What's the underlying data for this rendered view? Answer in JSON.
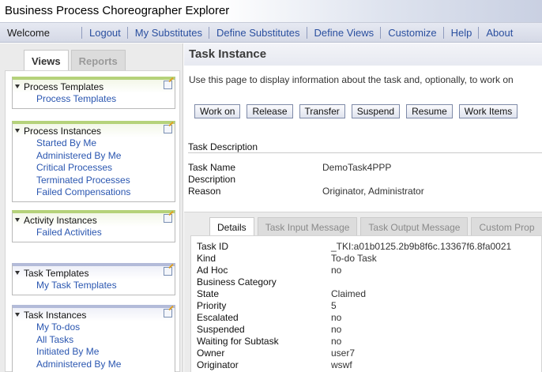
{
  "app": {
    "title": "Business Process Choreographer Explorer"
  },
  "nav": {
    "welcome": "Welcome",
    "links": [
      "Logout",
      "My Substitutes",
      "Define Substitutes",
      "Define Views",
      "Customize",
      "Help",
      "About"
    ]
  },
  "left_tabs": {
    "views": "Views",
    "reports": "Reports"
  },
  "sections": [
    {
      "title": "Process Templates",
      "items": [
        "Process Templates"
      ]
    },
    {
      "title": "Process Instances",
      "items": [
        "Started By Me",
        "Administered By Me",
        "Critical Processes",
        "Terminated Processes",
        "Failed Compensations"
      ]
    },
    {
      "title": "Activity Instances",
      "items": [
        "Failed Activities"
      ]
    },
    {
      "title": "Task Templates",
      "items": [
        "My Task Templates"
      ]
    },
    {
      "title": "Task Instances",
      "items": [
        "My To-dos",
        "All Tasks",
        "Initiated By Me",
        "Administered By Me"
      ]
    }
  ],
  "main": {
    "title": "Task Instance",
    "description": "Use this page to display information about the task and, optionally, to work on",
    "buttons": [
      "Work on",
      "Release",
      "Transfer",
      "Suspend",
      "Resume",
      "Work Items"
    ],
    "task_description_label": "Task Description",
    "fields": [
      {
        "label": "Task Name",
        "value": "DemoTask4PPP"
      },
      {
        "label": "Description",
        "value": ""
      },
      {
        "label": "Reason",
        "value": "Originator, Administrator"
      }
    ],
    "detail_tabs": [
      "Details",
      "Task Input Message",
      "Task Output Message",
      "Custom Prop"
    ],
    "details": [
      {
        "label": "Task ID",
        "value": "_TKI:a01b0125.2b9b8f6c.13367f6.8fa0021"
      },
      {
        "label": "Kind",
        "value": "To-do Task"
      },
      {
        "label": "Ad Hoc",
        "value": "no"
      },
      {
        "label": "Business Category",
        "value": ""
      },
      {
        "label": "State",
        "value": "Claimed"
      },
      {
        "label": "Priority",
        "value": "5"
      },
      {
        "label": "Escalated",
        "value": "no"
      },
      {
        "label": "Suspended",
        "value": "no"
      },
      {
        "label": "Waiting for Subtask",
        "value": "no"
      },
      {
        "label": "Owner",
        "value": "user7"
      },
      {
        "label": "Originator",
        "value": "wswf"
      }
    ]
  }
}
